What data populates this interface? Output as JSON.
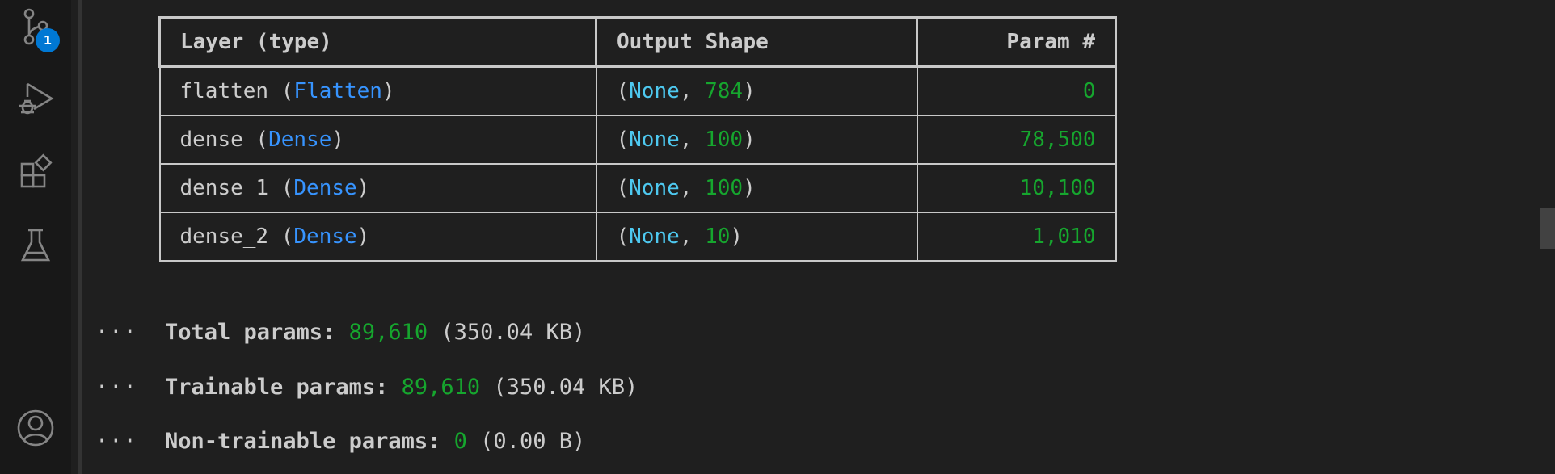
{
  "activity_bar": {
    "source_control_badge": "1",
    "icons": [
      "source-control-icon",
      "run-debug-icon",
      "extensions-icon",
      "testing-flask-icon",
      "account-icon"
    ]
  },
  "colors": {
    "background": "#1f1f1f",
    "layer_class": "#3794ff",
    "none_keyword": "#4ec9f0",
    "number": "#16a62e",
    "badge": "#0078d4"
  },
  "top_ellipsis": "···",
  "model_summary": {
    "headers": {
      "layer": "Layer (type)",
      "output": "Output Shape",
      "params": "Param #"
    },
    "rows": [
      {
        "name": "flatten",
        "type": "Flatten",
        "shape_none": "None",
        "shape_dim": "784",
        "params": "0"
      },
      {
        "name": "dense",
        "type": "Dense",
        "shape_none": "None",
        "shape_dim": "100",
        "params": "78,500"
      },
      {
        "name": "dense_1",
        "type": "Dense",
        "shape_none": "None",
        "shape_dim": "100",
        "params": "10,100"
      },
      {
        "name": "dense_2",
        "type": "Dense",
        "shape_none": "None",
        "shape_dim": "10",
        "params": "1,010"
      }
    ]
  },
  "totals": [
    {
      "ellipsis": "···",
      "label": "Total params:",
      "count": "89,610",
      "size": "(350.04 KB)"
    },
    {
      "ellipsis": "···",
      "label": "Trainable params:",
      "count": "89,610",
      "size": "(350.04 KB)"
    },
    {
      "ellipsis": "···",
      "label": "Non-trainable params:",
      "count": "0",
      "size": "(0.00 B)"
    }
  ]
}
